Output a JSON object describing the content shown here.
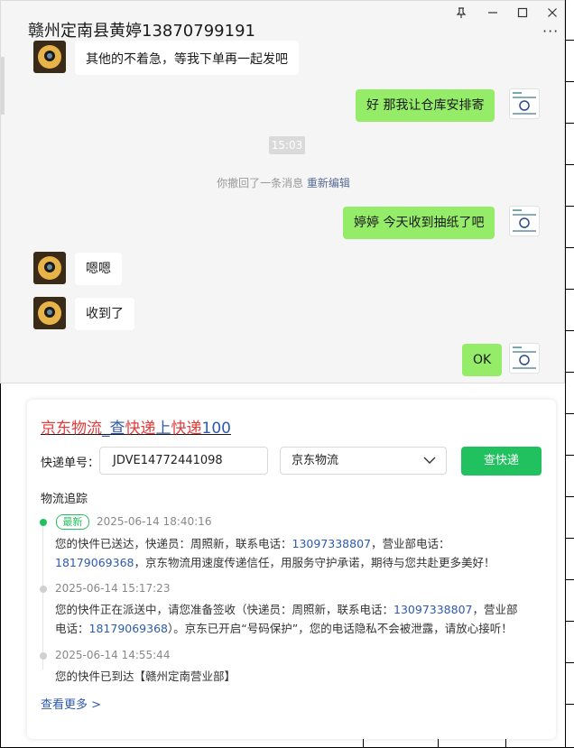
{
  "chat": {
    "title": "赣州定南县黄婷13870799191",
    "window_buttons": {
      "pin": "pin-icon",
      "minimize": "minimize-icon",
      "maximize": "maximize-icon",
      "close": "close-icon"
    },
    "more": "···",
    "messages": [
      {
        "side": "left",
        "text": "其他的不着急，等我下单再一起发吧"
      },
      {
        "side": "right",
        "text": "好  那我让仓库安排寄"
      },
      {
        "type": "time",
        "text": "15:03"
      },
      {
        "type": "system",
        "text": "你撤回了一条消息",
        "link": "重新编辑"
      },
      {
        "side": "right",
        "text": "婷婷  今天收到抽纸了吧"
      },
      {
        "side": "left",
        "text": "嗯嗯"
      },
      {
        "side": "left",
        "text": "收到了"
      },
      {
        "side": "right",
        "text": "OK"
      }
    ]
  },
  "card": {
    "brand": {
      "part1": "京东物流",
      "sep": "_",
      "part2": "查",
      "part3": "快递",
      "part4": "上",
      "part5": "快递",
      "part6": "100"
    },
    "tracking_label": "快递单号：",
    "tracking_value": "JDVE14772441098",
    "carrier_selected": "京东物流",
    "query_button": "查快递",
    "section_title": "物流追踪",
    "latest_badge": "最新",
    "events": [
      {
        "time": "2025-06-14 18:40:16",
        "line1_pre": "您的快件已送达，快递员：周照新，联系电话：",
        "line1_num": "13097338807",
        "line1_post": "，营业部电话：",
        "line2_num": "18179069368",
        "line2_post": "，京东物流用速度传递信任，用服务守护承诺，期待与您共赴更多美好！"
      },
      {
        "time": "2025-06-14 15:17:23",
        "line1_pre": "您的快件正在派送中，请您准备签收（快递员：周照新，联系电话：",
        "line1_num": "13097338807",
        "line1_post": "，营业部",
        "line2_pre": "电话：",
        "line2_num": "18179069368",
        "line2_post": "）。京东已开启“号码保护”，您的电话隐私不会被泄露，请放心接听！"
      },
      {
        "time": "2025-06-14 14:55:44",
        "text": "您的快件已到达【赣州定南营业部】"
      }
    ],
    "more_link": "查看更多 >"
  },
  "colors": {
    "bubble_right": "#95ec69",
    "accent_green": "#21c15f",
    "link_blue": "#2e5aac",
    "brand_red": "#e23c3c"
  }
}
